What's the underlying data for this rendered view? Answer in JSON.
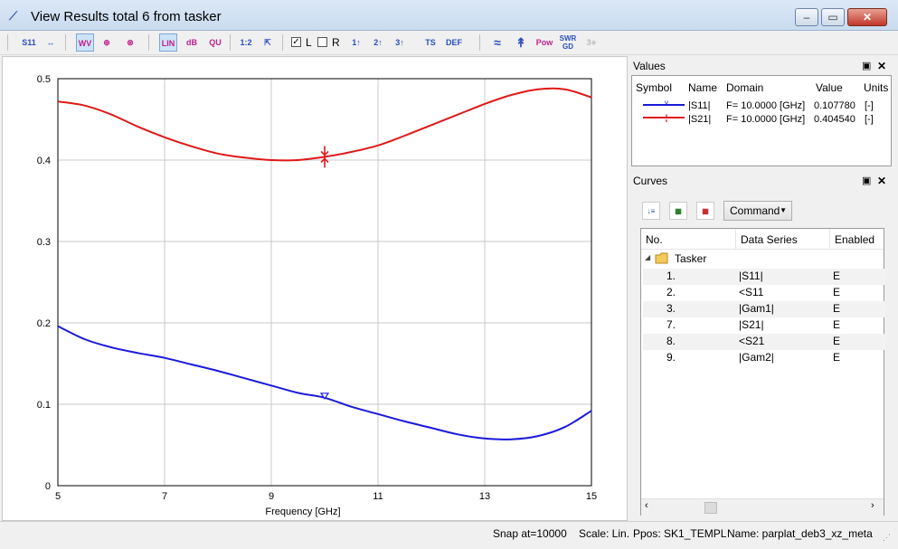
{
  "window": {
    "title": "View Results total 6 from tasker"
  },
  "toolbar": {
    "buttons": [
      "S11",
      "↔",
      "WV",
      "⊕",
      "⊗",
      "LIN",
      "dB",
      "QU",
      "1:2",
      "⇱",
      "1↑",
      "2↑",
      "3↑",
      "TS",
      "DEF",
      "≈",
      "↟",
      "Pow",
      "SWR GD",
      "3⋄"
    ],
    "check_l": "L",
    "check_r": "R"
  },
  "chart_data": {
    "type": "line",
    "xlabel": "Frequency [GHz]",
    "ylabel": "",
    "xlim": [
      5,
      15
    ],
    "ylim": [
      0,
      0.5
    ],
    "x_ticks": [
      "5",
      "7",
      "9",
      "11",
      "13",
      "15"
    ],
    "y_ticks": [
      "0",
      "0.1",
      "0.2",
      "0.3",
      "0.4",
      "0.5"
    ],
    "grid": true,
    "series": [
      {
        "name": "|S11|",
        "color": "#1a1adc",
        "marker": "triangle-down",
        "marker_x": 10,
        "x": [
          5,
          5.5,
          6,
          6.5,
          7,
          7.5,
          8,
          8.5,
          9,
          9.5,
          10,
          10.5,
          11,
          11.5,
          12,
          12.5,
          13,
          13.5,
          14,
          14.5,
          15
        ],
        "y": [
          0.196,
          0.18,
          0.17,
          0.163,
          0.157,
          0.149,
          0.141,
          0.132,
          0.123,
          0.114,
          0.108,
          0.097,
          0.088,
          0.079,
          0.071,
          0.063,
          0.058,
          0.057,
          0.061,
          0.072,
          0.092
        ]
      },
      {
        "name": "|S21|",
        "color": "#e01818",
        "marker": "cross-arrow",
        "marker_x": 10,
        "x": [
          5,
          5.5,
          6,
          6.5,
          7,
          7.5,
          8,
          8.5,
          9,
          9.5,
          10,
          10.5,
          11,
          11.5,
          12,
          12.5,
          13,
          13.5,
          14,
          14.5,
          15
        ],
        "y": [
          0.472,
          0.467,
          0.456,
          0.441,
          0.428,
          0.417,
          0.408,
          0.403,
          0.4,
          0.4,
          0.404,
          0.41,
          0.418,
          0.43,
          0.443,
          0.456,
          0.469,
          0.48,
          0.487,
          0.487,
          0.477
        ]
      }
    ]
  },
  "values_pane": {
    "title": "Values",
    "headers": [
      "Symbol",
      "Name",
      "Domain",
      "Value",
      "Units"
    ],
    "rows": [
      {
        "name": "|S11|",
        "domain": "F= 10.0000 [GHz]",
        "value": "0.107780",
        "units": "[-]",
        "color": "#1a1adc"
      },
      {
        "name": "|S21|",
        "domain": "F= 10.0000 [GHz]",
        "value": "0.404540",
        "units": "[-]",
        "color": "#e01818"
      }
    ]
  },
  "curves_pane": {
    "title": "Curves",
    "command_label": "Command",
    "headers": [
      "No.",
      "Data Series",
      "Enabled"
    ],
    "group": "Tasker",
    "rows": [
      {
        "no": "1.",
        "series": "|S11|",
        "enabled": "E"
      },
      {
        "no": "2.",
        "series": "<S11",
        "enabled": "E"
      },
      {
        "no": "3.",
        "series": "|Gam1|",
        "enabled": "E"
      },
      {
        "no": "7.",
        "series": "|S21|",
        "enabled": "E"
      },
      {
        "no": "8.",
        "series": "<S21",
        "enabled": "E"
      },
      {
        "no": "9.",
        "series": "|Gam2|",
        "enabled": "E"
      }
    ]
  },
  "statusbar": {
    "snap": "Snap at=10000",
    "scale": "Scale: Lin.",
    "ppos": "Ppos: SK1_TEMPL",
    "name": "Name: parplat_deb3_xz_meta"
  }
}
